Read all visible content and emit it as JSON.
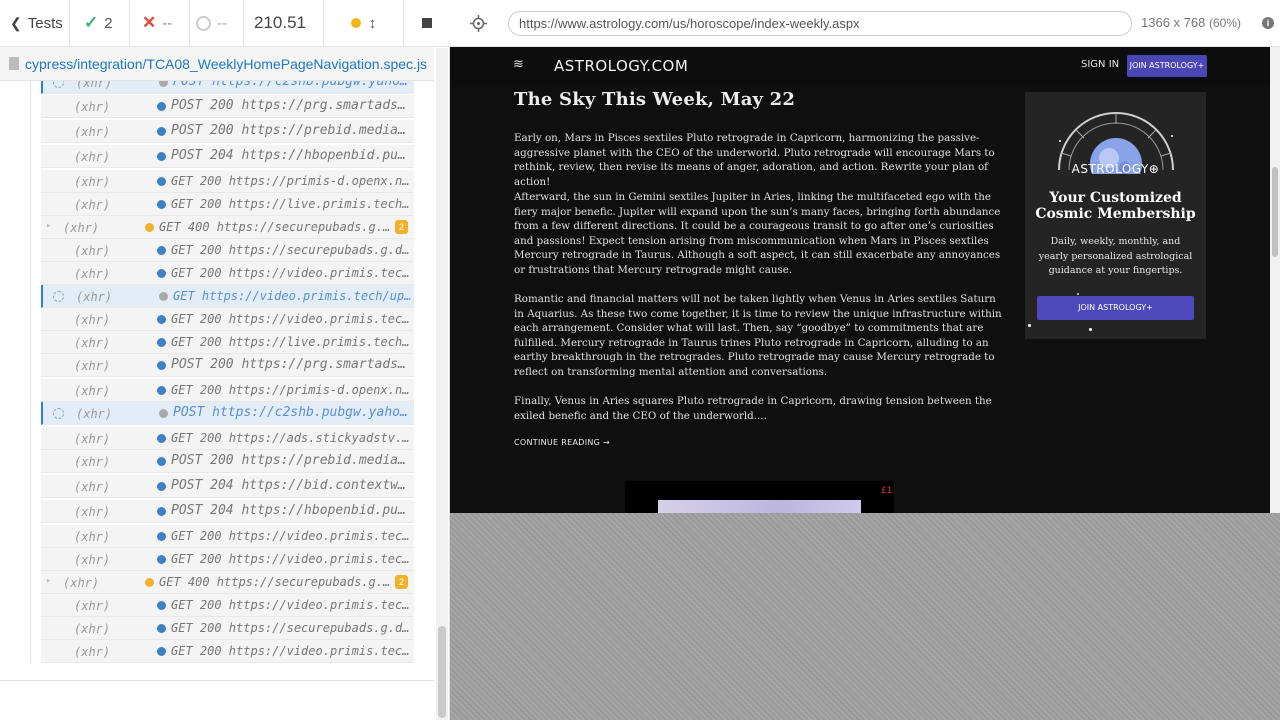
{
  "reporter": {
    "tests_label": "Tests",
    "passed_count": "2",
    "failed_count": "--",
    "pending_count": "--",
    "duration": "210.51",
    "spec_path": "cypress/integration/TCA08_WeeklyHomePageNavigation.spec.js",
    "commands": [
      {
        "type": "(xhr)",
        "msg": "POST https://c2shb.pubgw.yahoo.com/..."
      },
      {
        "type": "(xhr)",
        "msg": "POST 200 https://prg.smartadserver.com/..."
      },
      {
        "type": "(xhr)",
        "msg": "POST 200 https://prebid.media.net/..."
      },
      {
        "type": "(xhr)",
        "msg": "POST 204 https://hbopenbid.pubmatic.com/..."
      },
      {
        "type": "(xhr)",
        "msg": "GET 200 https://primis-d.openx.net/v/1.0/..."
      },
      {
        "type": "(xhr)",
        "msg": "GET 200 https://live.primis.tech/live/..."
      },
      {
        "type": "(xhr)",
        "msg": "GET 400 https://securepubads.g.doubleclick.net/...",
        "badge": "2"
      },
      {
        "type": "(xhr)",
        "msg": "GET 200 https://securepubads.g.doubleclick.net/..."
      },
      {
        "type": "(xhr)",
        "msg": "GET 200 https://video.primis.tech/uploads/..."
      },
      {
        "type": "(xhr)",
        "msg": "GET https://video.primis.tech/uploads/..."
      },
      {
        "type": "(xhr)",
        "msg": "GET 200 https://video.primis.tech/uploads/..."
      },
      {
        "type": "(xhr)",
        "msg": "GET 200 https://live.primis.tech/live/..."
      },
      {
        "type": "(xhr)",
        "msg": "POST 200 https://prg.smartadserver.com/..."
      },
      {
        "type": "(xhr)",
        "msg": "GET 200 https://primis-d.openx.net/v/1.0/..."
      },
      {
        "type": "(xhr)",
        "msg": "POST https://c2shb.pubgw.yahoo.com/..."
      },
      {
        "type": "(xhr)",
        "msg": "GET 200 https://ads.stickyadstv.com/www/..."
      },
      {
        "type": "(xhr)",
        "msg": "POST 200 https://prebid.media.net/..."
      },
      {
        "type": "(xhr)",
        "msg": "POST 204 https://bid.contextweb.com/..."
      },
      {
        "type": "(xhr)",
        "msg": "POST 204 https://hbopenbid.pubmatic.com/..."
      },
      {
        "type": "(xhr)",
        "msg": "GET 200 https://video.primis.tech/uploads/..."
      },
      {
        "type": "(xhr)",
        "msg": "GET 200 https://video.primis.tech/uploads/..."
      },
      {
        "type": "(xhr)",
        "msg": "GET 400 https://securepubads.g.doubleclick.net/...",
        "badge": "2"
      },
      {
        "type": "(xhr)",
        "msg": "GET 200 https://video.primis.tech/uploads/..."
      },
      {
        "type": "(xhr)",
        "msg": "GET 200 https://securepubads.g.doubleclick.net/..."
      },
      {
        "type": "(xhr)",
        "msg": "GET 200 https://video.primis.tech/uploads/..."
      }
    ]
  },
  "aut": {
    "url": "https://www.astrology.com/us/horoscope/index-weekly.aspx",
    "viewport_size": "1366 x 768",
    "viewport_scale": "(60%)"
  },
  "site": {
    "logo": "ASTROLOGY.COM",
    "sign_in": "SIGN IN",
    "join_nav": "JOIN ASTROLOGY+",
    "title": "The Sky This Week, May 22",
    "paragraphs": [
      "Early on, Mars in Pisces sextiles Pluto retrograde in Capricorn, harmonizing the passive-aggressive planet with the CEO of the underworld. Pluto retrograde will encourage Mars to rethink, review, then revise its means of anger, adoration, and action. Rewrite your plan of action!",
      "Afterward, the sun in Gemini sextiles Jupiter in Aries, linking the multifaceted ego with the fiery major benefic. Jupiter will expand upon the sun’s many faces, bringing forth abundance from a few different directions. It could be a courageous transit to go after one’s curiosities and passions! Expect tension arising from miscommunication when Mars in Pisces sextiles Mercury retrograde in Taurus. Although a soft aspect, it can still exacerbate any annoyances or frustrations that Mercury retrograde might cause.",
      "Romantic and financial matters will not be taken lightly when Venus in Aries sextiles Saturn in Aquarius. As these two come together, it is time to review the unique infrastructure within each arrangement. Consider what will last. Then, say “goodbye” to commitments that are fulfilled. Mercury retrograde in Taurus trines Pluto retrograde in Capricorn, alluding to an earthy breakthrough in the retrogrades. Pluto retrograde may cause Mercury retrograde to reflect on transforming mental attention and conversations.",
      "Finally, Venus in Aries squares Pluto retrograde in Capricorn, drawing tension between the exiled benefic and the CEO of the underworld...."
    ],
    "continue": "CONTINUE READING →",
    "promo": {
      "brand": "ASTROLOGY⊕",
      "title": "Your Customized Cosmic Membership",
      "description": "Daily, weekly, monthly, and yearly personalized astrological guidance at your fingertips.",
      "button": "JOIN ASTROLOGY+"
    },
    "ad_close": "£1"
  }
}
